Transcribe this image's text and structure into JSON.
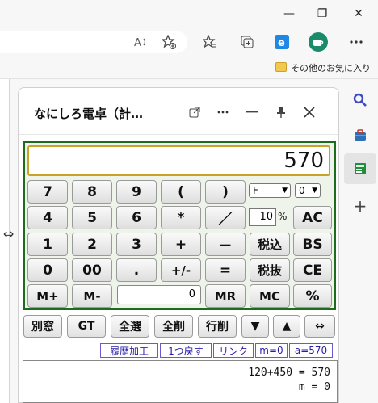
{
  "browser": {
    "window_controls": [
      "—",
      "❐",
      "✕"
    ],
    "favorites_bar": {
      "folder_label": "その他のお気に入り"
    }
  },
  "panel": {
    "title": "なにしろ電卓（計…",
    "icons": [
      "open-in-new-window-icon",
      "more-options-icon",
      "minimize-icon",
      "pin-icon",
      "close-icon"
    ]
  },
  "calculator": {
    "display": "570",
    "rounding_select": "F",
    "digits_select": "0",
    "tax_rate": "10",
    "tax_rate_unit": "%",
    "memory_value": "0",
    "keys": {
      "row1": [
        "7",
        "8",
        "9",
        "(",
        ")"
      ],
      "row2": [
        "4",
        "5",
        "6",
        "*",
        "／",
        "AC"
      ],
      "row3": [
        "1",
        "2",
        "3",
        "+",
        "－",
        "税込",
        "BS"
      ],
      "row4": [
        "0",
        "00",
        ".",
        "+/-",
        "=",
        "税抜",
        "CE"
      ],
      "row5": [
        "M+",
        "M-",
        "MR",
        "MC",
        "%"
      ]
    }
  },
  "function_buttons": [
    "別窓",
    "GT",
    "全選",
    "全削",
    "行削",
    "▼",
    "▲",
    "⇔"
  ],
  "links": [
    "履歴加工",
    "1つ戻す",
    "リンク",
    "m=0",
    "a=570"
  ],
  "history": [
    "120+450 = 570",
    "m = 0"
  ]
}
